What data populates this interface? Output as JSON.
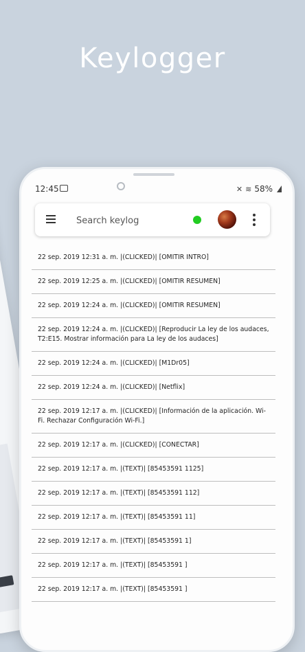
{
  "promo": {
    "title": "Keylogger"
  },
  "status_bar": {
    "time": "12:45",
    "battery": "58%"
  },
  "search": {
    "placeholder": "Search keylog"
  },
  "colors": {
    "online_dot": "#22cc22",
    "background": "#c9d3de"
  },
  "log_entries": [
    "22 sep. 2019 12:31 a. m. |(CLICKED)| [OMITIR INTRO]",
    "22 sep. 2019 12:25 a. m. |(CLICKED)| [OMITIR RESUMEN]",
    "22 sep. 2019 12:24 a. m. |(CLICKED)| [OMITIR RESUMEN]",
    "22 sep. 2019 12:24 a. m. |(CLICKED)| [Reproducir La ley de los audaces, T2:E15. Mostrar información para La ley de los audaces]",
    "22 sep. 2019 12:24 a. m. |(CLICKED)| [M1Dr05]",
    "22 sep. 2019 12:24 a. m. |(CLICKED)| [Netflix]",
    "22 sep. 2019 12:17 a. m. |(CLICKED)| [Información de la aplicación. Wi-Fi. Rechazar Configuración Wi-Fi.]",
    "22 sep. 2019 12:17 a. m. |(CLICKED)| [CONECTAR]",
    "22 sep. 2019 12:17 a. m. |(TEXT)| [85453591 1125]",
    "22 sep. 2019 12:17 a. m. |(TEXT)| [85453591 112]",
    "22 sep. 2019 12:17 a. m. |(TEXT)| [85453591 11]",
    "22 sep. 2019 12:17 a. m. |(TEXT)| [85453591 1]",
    "22 sep. 2019 12:17 a. m. |(TEXT)| [85453591 ]",
    "22 sep. 2019 12:17 a. m. |(TEXT)| [85453591 ]"
  ]
}
